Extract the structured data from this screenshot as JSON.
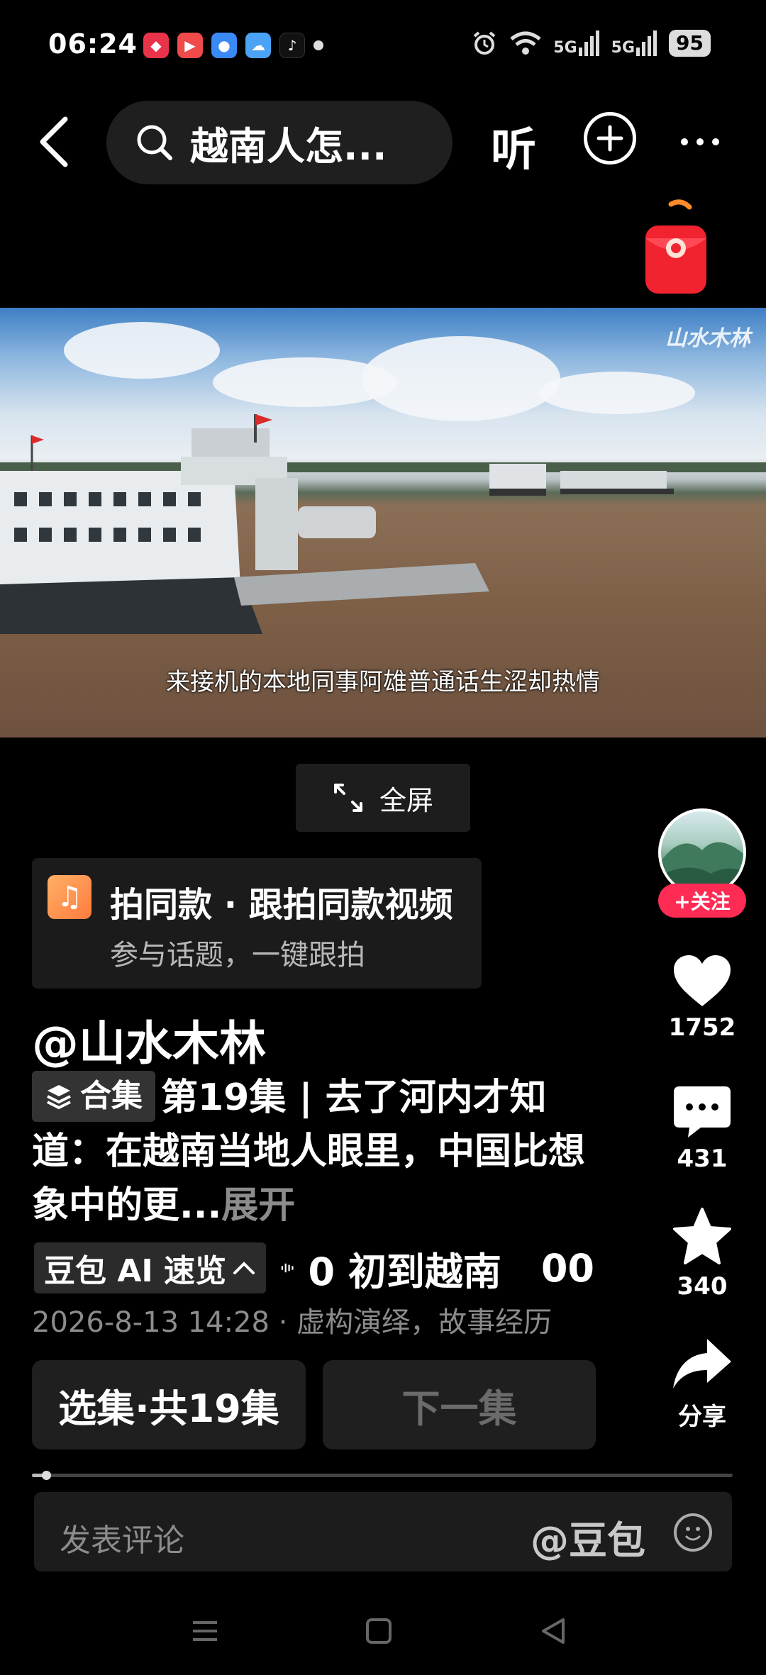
{
  "status_bar": {
    "time": "06:24",
    "network_1": "5G",
    "network_2": "5G",
    "battery": "95"
  },
  "top_bar": {
    "search_text": "越南人怎...",
    "listen_label": "听"
  },
  "video": {
    "watermark": "山水木林",
    "subtitle": "来接机的本地同事阿雄普通话生涩却热情"
  },
  "fullscreen_label": "全屏",
  "right_rail": {
    "follow_label": "+关注",
    "like_count": "1752",
    "comment_count": "431",
    "favorite_count": "340",
    "share_label": "分享"
  },
  "same_style_card": {
    "title": "拍同款 · 跟拍同款视频",
    "subtitle": "参与话题，一键跟拍"
  },
  "author": "@山水木林",
  "description": {
    "collection_tag": "合集",
    "text": "第19集 | 去了河内才知道：在越南当地人眼里，中国比想象中的更...",
    "expand_label": "展开"
  },
  "ai_row": {
    "tag": "豆包 AI 速览",
    "item_1": "0 初到越南",
    "item_2": "00"
  },
  "meta": "2026-8-13 14:28 · 虚构演绎，故事经历",
  "buttons": {
    "episodes": "选集·共19集",
    "next": "下一集"
  },
  "playback_progress": 0.02,
  "comment_bar": {
    "placeholder": "发表评论",
    "mention": "@豆包"
  },
  "colors": {
    "accent_red": "#fe2c55",
    "background": "#000000"
  }
}
